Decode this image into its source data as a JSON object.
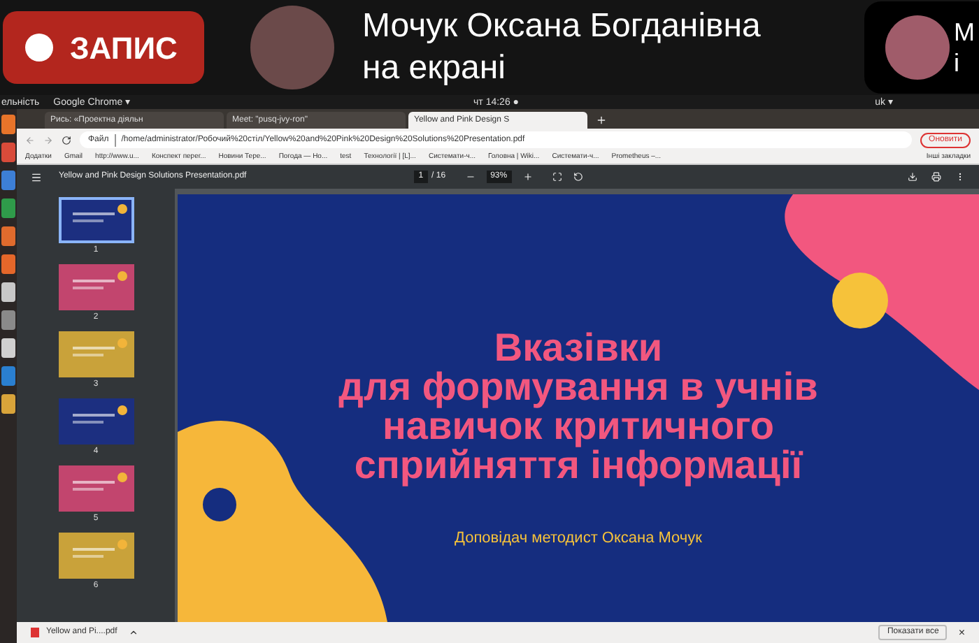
{
  "call_bar": {
    "record_button": "ЗАПИС",
    "presenter": {
      "line_1": "Мочук Оксана Богданівна",
      "line_2": "на екрані"
    },
    "participant": {
      "line_1": "М",
      "line_2": "і"
    }
  },
  "system_bar": {
    "app_left": "ельність",
    "app_name": "Google Chrome ▾",
    "clock": "чт 14:26 ●",
    "language": "uk ▾"
  },
  "tabs": [
    {
      "label": "Рись: «Проектна діяльн",
      "selected": false
    },
    {
      "label": "Meet: \"pusq-jvy-ron\"",
      "selected": false
    },
    {
      "label": "Yellow and Pink Design S",
      "selected": true
    }
  ],
  "address_bar": {
    "prefix": "Файл",
    "url": "/home/administrator/Робочий%20стіл/Yellow%20and%20Pink%20Design%20Solutions%20Presentation.pdf",
    "update_button": "Оновити"
  },
  "bookmarks": [
    "Додатки",
    "Gmail",
    "http://www.u...",
    "Конспект перег...",
    "Новини Тере...",
    "Погода — Но...",
    "test",
    "Технології | [L]...",
    "Системати-ч...",
    "Головна | Wiki...",
    "Системати-ч...",
    "Prometheus –..."
  ],
  "other_bookmarks": "Інші закладки",
  "pdf_toolbar": {
    "title": "Yellow and Pink Design Solutions Presentation.pdf",
    "page": "1",
    "page_total": "/ 16",
    "zoom": "93%"
  },
  "thumbnails": [
    {
      "number": "1",
      "selected": true,
      "color": "#1c2f80"
    },
    {
      "number": "2",
      "selected": false,
      "color": "#c2456e"
    },
    {
      "number": "3",
      "selected": false,
      "color": "#c9a23a"
    },
    {
      "number": "4",
      "selected": false,
      "color": "#1c2f80"
    },
    {
      "number": "5",
      "selected": false,
      "color": "#c2456e"
    },
    {
      "number": "6",
      "selected": false,
      "color": "#c9a23a"
    }
  ],
  "slide": {
    "title": [
      "Вказівки",
      "для формування в учнів",
      "навичок критичного",
      "сприйняття інформації"
    ],
    "subtitle": "Доповідач методист Оксана Мочук"
  },
  "download_bar": {
    "file": "Yellow and Pi....pdf",
    "show_all": "Показати все",
    "close": "×"
  }
}
